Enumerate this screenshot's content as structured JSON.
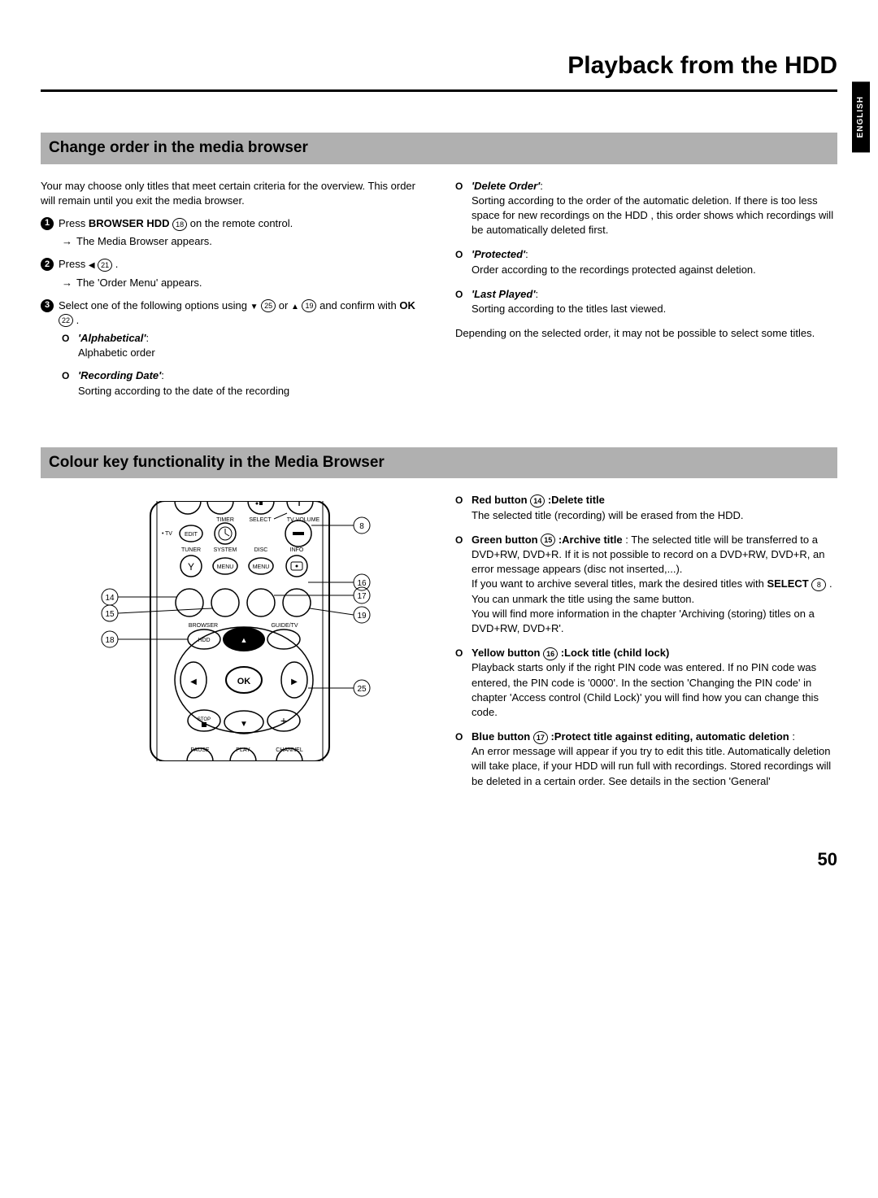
{
  "page": {
    "title": "Playback from the HDD",
    "language_tab": "ENGLISH",
    "number": "50"
  },
  "section1": {
    "heading": "Change order in the media browser",
    "intro": "Your may choose only titles that meet certain criteria for the overview. This order will remain until you exit the media browser.",
    "step1_a": "Press ",
    "step1_key": "BROWSER HDD",
    "step1_ref": "18",
    "step1_b": " on the remote control.",
    "step1_sub": "The Media Browser appears.",
    "step2_a": "Press ",
    "step2_ref": "21",
    "step2_b": " .",
    "step2_sub": "The 'Order Menu' appears.",
    "step3_a": "Select one of the following options using ",
    "step3_ref1": "25",
    "step3_mid": " or ",
    "step3_ref2": "19",
    "step3_b": " and confirm with ",
    "step3_ok": "OK",
    "step3_okref": "22",
    "step3_c": " .",
    "opt_alpha_label": "'Alphabetical'",
    "opt_alpha_desc": "Alphabetic order",
    "opt_recdate_label": "'Recording Date'",
    "opt_recdate_desc": "Sorting according to the date of the recording",
    "opt_delete_label": "'Delete Order'",
    "opt_delete_desc": "Sorting according to the order of the automatic deletion. If there is too less space for new recordings on the HDD , this order shows which recordings will be automatically deleted first.",
    "opt_protected_label": "'Protected'",
    "opt_protected_desc": "Order according to the recordings protected against deletion.",
    "opt_lastplayed_label": "'Last Played'",
    "opt_lastplayed_desc": "Sorting according to the titles last viewed.",
    "footnote": "Depending on the selected order, it may not be possible to select some titles."
  },
  "section2": {
    "heading": "Colour key functionality in the Media Browser",
    "red_label": "Red button ",
    "red_ref": "14",
    "red_title": " :Delete title",
    "red_desc": "The selected title (recording) will be erased from the HDD.",
    "green_label": "Green button ",
    "green_ref": "15",
    "green_title": " :Archive title",
    "green_desc1": ": The selected title will be transferred to a DVD+RW, DVD+R. If it is not possible to record on a DVD+RW, DVD+R, an error message appears (disc not inserted,...).",
    "green_desc2a": "If you want to archive several titles, mark the desired titles with ",
    "green_select": "SELECT",
    "green_selref": "8",
    "green_desc2b": " . You can unmark the title using the same button.",
    "green_desc3": "You will find more information in the chapter 'Archiving (storing) titles on a DVD+RW, DVD+R'.",
    "yellow_label": "Yellow button ",
    "yellow_ref": "16",
    "yellow_title": " :Lock title (child lock)",
    "yellow_desc": "Playback starts only if the right PIN code was entered. If no PIN code was entered, the PIN code is '0000'. In the section 'Changing the PIN code' in chapter 'Access control (Child Lock)' you will find how you can change this code.",
    "blue_label": "Blue button ",
    "blue_ref": "17",
    "blue_title": " :Protect title against editing, automatic deletion",
    "blue_desc": "An error message will appear if you try to edit this title. Automatically deletion will take place, if your HDD will run full with recordings. Stored recordings will be deleted in a certain order. See details in the section 'General'"
  },
  "remote": {
    "labels": {
      "timer": "TIMER",
      "select": "SELECT",
      "tvvol": "TV VOLUME",
      "tv": "TV",
      "edit": "EDIT",
      "tuner": "TUNER",
      "system": "SYSTEM",
      "disc": "DISC",
      "info": "INFO",
      "menu1": "MENU",
      "menu2": "MENU",
      "browser": "BROWSER",
      "guidetv": "GUIDE/TV",
      "hdd": "HDD",
      "ok": "OK",
      "stop": "STOP",
      "pause": "PAUSE",
      "play": "PLAY",
      "channel": "CHANNEL"
    },
    "callouts": [
      "8",
      "14",
      "15",
      "16",
      "17",
      "18",
      "19",
      "25"
    ]
  }
}
